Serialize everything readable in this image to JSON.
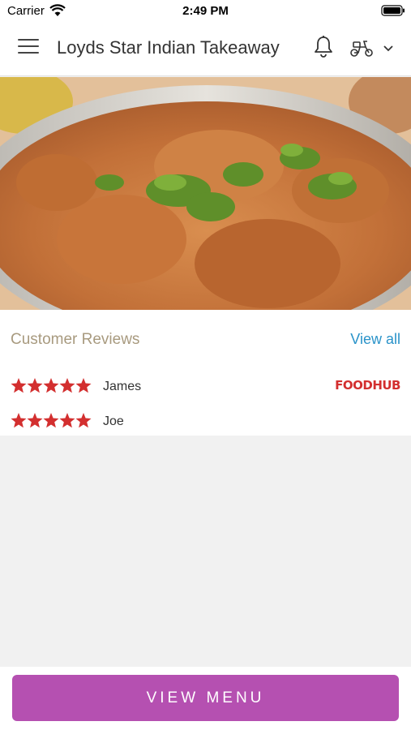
{
  "status_bar": {
    "carrier": "Carrier",
    "time": "2:49 PM"
  },
  "header": {
    "title": "Loyds Star Indian Takeaway",
    "icons": [
      "menu-icon",
      "bell-icon",
      "scooter-icon",
      "chevron-down-icon"
    ]
  },
  "hero": {
    "icon": "curry-dish-photo"
  },
  "reviews": {
    "title": "Customer Reviews",
    "view_all": "View all",
    "brand": "FOODHUB",
    "items": [
      {
        "name": "James",
        "rating": 5
      },
      {
        "name": "Joe",
        "rating": 5
      }
    ]
  },
  "colors": {
    "accent": "#b550b1",
    "link": "#2a93c9",
    "star": "#d32f2f",
    "section_title": "#a89a7f"
  },
  "footer": {
    "view_menu": "VIEW MENU"
  }
}
